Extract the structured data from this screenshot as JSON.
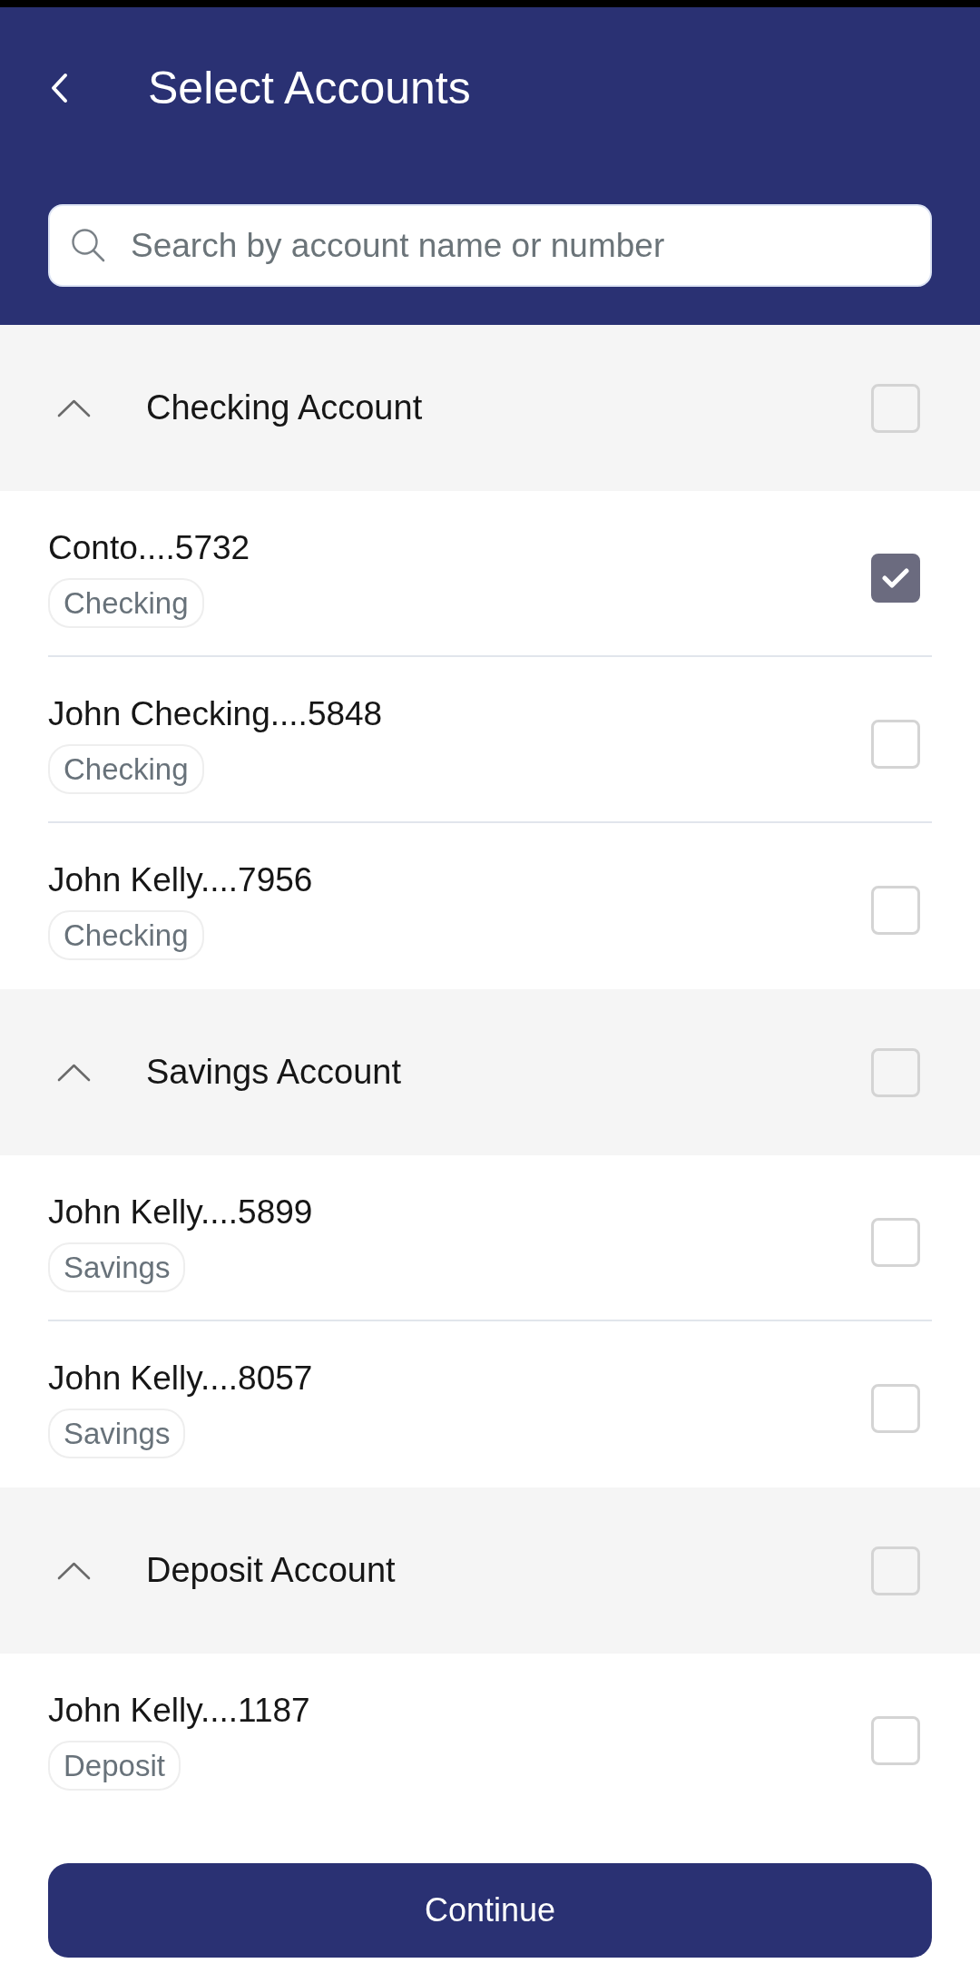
{
  "header": {
    "title": "Select Accounts"
  },
  "search": {
    "placeholder": "Search by account name or number"
  },
  "groups": [
    {
      "title": "Checking Account",
      "expanded": true,
      "checked": false,
      "accounts": [
        {
          "name": "Conto....5732",
          "tag": "Checking",
          "checked": true
        },
        {
          "name": "John Checking....5848",
          "tag": "Checking",
          "checked": false
        },
        {
          "name": "John Kelly....7956",
          "tag": "Checking",
          "checked": false
        }
      ]
    },
    {
      "title": "Savings Account",
      "expanded": true,
      "checked": false,
      "accounts": [
        {
          "name": "John Kelly....5899",
          "tag": "Savings",
          "checked": false
        },
        {
          "name": "John Kelly....8057",
          "tag": "Savings",
          "checked": false
        }
      ]
    },
    {
      "title": "Deposit Account",
      "expanded": true,
      "checked": false,
      "accounts": [
        {
          "name": "John Kelly....1187",
          "tag": "Deposit",
          "checked": false
        }
      ]
    }
  ],
  "continue_button": {
    "label": "Continue"
  }
}
